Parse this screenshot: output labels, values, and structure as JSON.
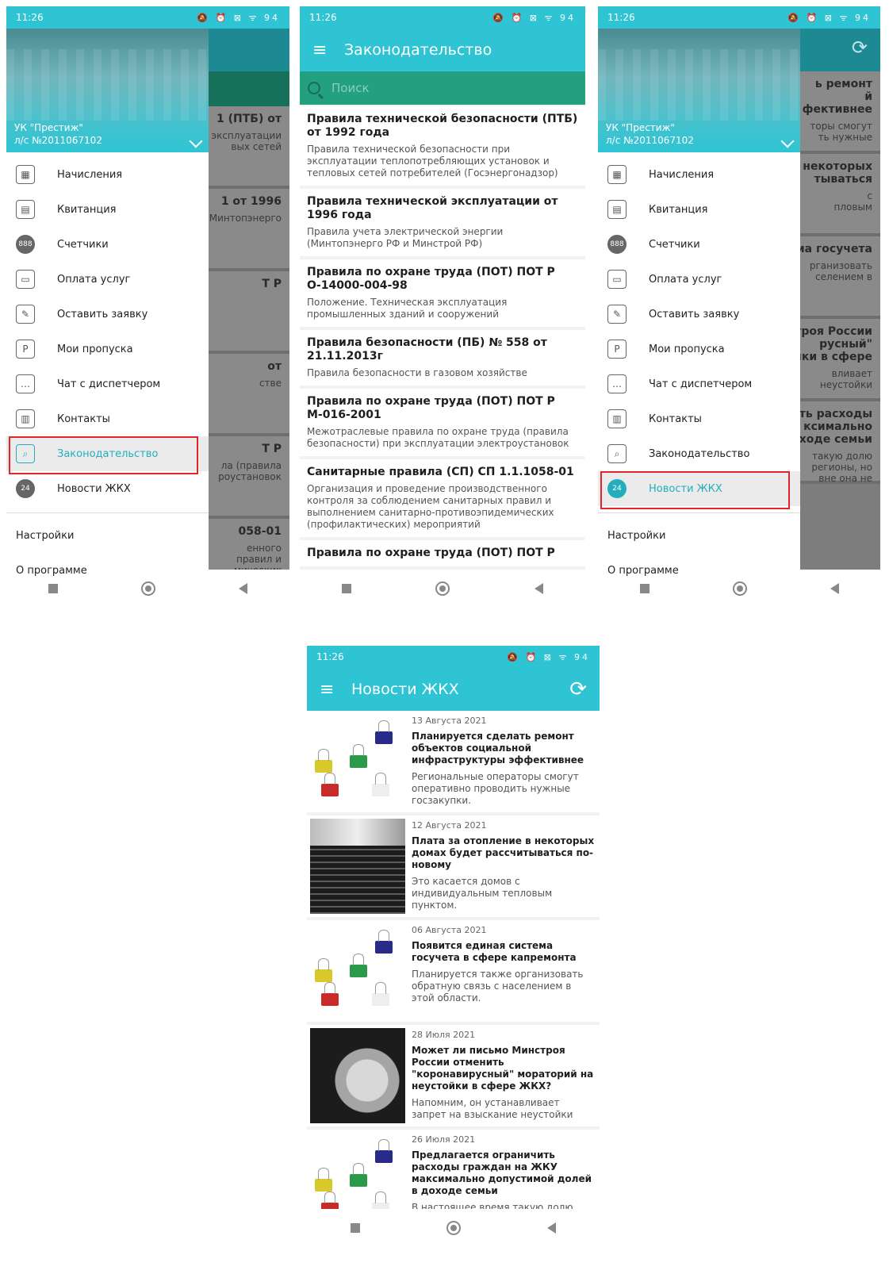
{
  "status": {
    "time": "11:26",
    "icons": "🔕 ⏰ ⊠ ᯤ 94"
  },
  "drawer": {
    "org": "УК \"Престиж\"",
    "account": "л/с №2011067102",
    "items": [
      {
        "label": "Начисления",
        "icon": "▦"
      },
      {
        "label": "Квитанция",
        "icon": "▤"
      },
      {
        "label": "Счетчики",
        "icon": "888"
      },
      {
        "label": "Оплата услуг",
        "icon": "▭"
      },
      {
        "label": "Оставить заявку",
        "icon": "✎"
      },
      {
        "label": "Мои пропуска",
        "icon": "P"
      },
      {
        "label": "Чат с диспетчером",
        "icon": "…"
      },
      {
        "label": "Контакты",
        "icon": "▥"
      },
      {
        "label": "Законодательство",
        "icon": "⌕"
      },
      {
        "label": "Новости ЖКХ",
        "icon": "24"
      }
    ],
    "settings": "Настройки",
    "about": "О программе"
  },
  "dim_left": [
    {
      "t": "1 (ПТБ) от",
      "d": "эксплуатации\nвых сетей"
    },
    {
      "t": "1 от 1996",
      "d": "Минтопэнерго"
    },
    {
      "t": "Т Р",
      "d": ""
    },
    {
      "t": "от",
      "d": "стве"
    },
    {
      "t": "Т Р",
      "d": "ла (правила\nроустановок"
    },
    {
      "t": "058-01",
      "d": "енного\nправил и\nмических"
    }
  ],
  "dim_right": [
    {
      "t": "ь ремонт\nй\nфективнее",
      "d": "торы смогут\nть нужные"
    },
    {
      "t": "в некоторых\nтываться",
      "d": "с\nпловым"
    },
    {
      "t": "стема госучета",
      "d": "рганизовать\nселением в"
    },
    {
      "t": "инстроя России\nрусный\"\nойки в сфере",
      "d": "вливает\nнеустойки"
    },
    {
      "t": "ничить расходы\nксимально\nдоходе семьи",
      "d": "такую долю\nрегионы, но\nвне она не"
    }
  ],
  "legislation": {
    "title": "Законодательство",
    "search_placeholder": "Поиск",
    "items": [
      {
        "title": "Правила технической безопасности (ПТБ) от 1992 года",
        "desc": "Правила технической безопасности при эксплуатации теплопотребляющих установок и тепловых сетей потребителей (Госэнергонадзор)"
      },
      {
        "title": "Правила технической эксплуатации от 1996 года",
        "desc": "Правила учета электрической энергии (Минтопэнерго РФ и Минстрой РФ)"
      },
      {
        "title": "Правила по охране труда (ПОТ) ПОТ Р О-14000-004-98",
        "desc": "Положение. Техническая эксплуатация промышленных зданий и сооружений"
      },
      {
        "title": "Правила безопасности (ПБ) № 558 от 21.11.2013г",
        "desc": "Правила безопасности в газовом хозяйстве"
      },
      {
        "title": "Правила по охране труда (ПОТ) ПОТ Р М-016-2001",
        "desc": "Межотраслевые правила по охране труда (правила безопасности) при эксплуатации электроустановок"
      },
      {
        "title": "Санитарные правила (СП) СП 1.1.1058-01",
        "desc": "Организация и проведение производственного контроля за соблюдением санитарных правил и выполнением санитарно-противоэпидемических (профилактических) мероприятий"
      },
      {
        "title": "Правила по охране труда (ПОТ) ПОТ Р",
        "desc": ""
      }
    ]
  },
  "news": {
    "title": "Новости ЖКХ",
    "items": [
      {
        "date": "13 Августа 2021",
        "title": "Планируется сделать ремонт объектов социальной инфраструктуры эффективнее",
        "desc": "Региональные операторы смогут оперативно проводить нужные госзакупки.",
        "thumb": "clips"
      },
      {
        "date": "12 Августа 2021",
        "title": "Плата за отопление в некоторых домах будет рассчитываться по-новому",
        "desc": "Это касается домов с индивидуальным тепловым пунктом.",
        "thumb": "stairs"
      },
      {
        "date": "06 Августа 2021",
        "title": "Появится единая система госучета в сфере капремонта",
        "desc": "Планируется также организовать обратную связь с населением в этой области.",
        "thumb": "clips"
      },
      {
        "date": "28 Июля 2021",
        "title": "Может ли письмо Минстроя России отменить \"коронавирусный\" мораторий на неустойки в сфере ЖКХ?",
        "desc": "Напомним, он устанавливает запрет на взыскание неустойки",
        "thumb": "thumbs"
      },
      {
        "date": "26 Июля 2021",
        "title": "Предлагается ограничить расходы граждан на ЖКУ максимально допустимой долей в доходе семьи",
        "desc": "В настоящее время такую долю могут устанавливать регионы, но на федеральном уровне она не",
        "thumb": "clips"
      }
    ]
  },
  "colors": {
    "accent": "#2ec4d4",
    "active_text": "#24aebd",
    "search_bar": "#23a07f",
    "highlight_box": "#e0262b"
  }
}
